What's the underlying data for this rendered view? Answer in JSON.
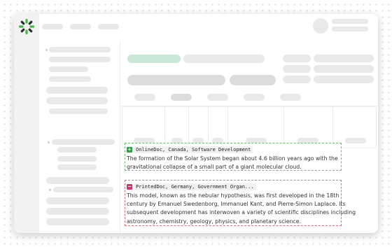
{
  "colors": {
    "added": "#2f9e44",
    "removed": "#d6336c",
    "added_border": "#6cc36c",
    "removed_border": "#e0707a"
  },
  "diff_blocks": [
    {
      "status": "added",
      "icon": "plus-icon",
      "marker": "+",
      "source": "OnlineDoc, Canada, Software Development",
      "lines": [
        "The formation of the Solar System began about 4.6 billion years ago with the",
        "gravitational collapse of a small part of a giant molecular cloud."
      ]
    },
    {
      "status": "removed",
      "icon": "minus-icon",
      "marker": "−",
      "source": "PrintedDoc, Germany, Government Organ...",
      "lines": [
        "This model, known as the nebular hypothesis, was first developed in the 18th",
        "century by Emanuel Swedenborg, Immanuel Kant, and Pierre-Simon Laplace. Its",
        "subsequent development has interwoven a variety of scientific disciplines including",
        "astronomy, chemistry, geology, physics, and planetary science."
      ]
    }
  ]
}
